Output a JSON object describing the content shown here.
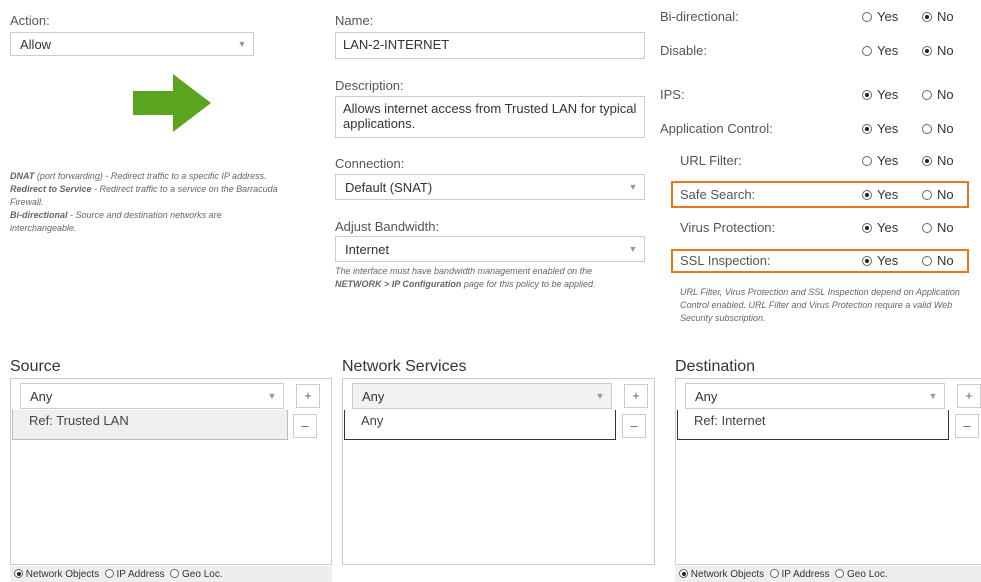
{
  "action": {
    "label": "Action:",
    "value": "Allow"
  },
  "help_left": {
    "dnat_term": "DNAT",
    "dnat_text": " (port forwarding) - Redirect traffic to a specific IP address.",
    "redirect_term": "Redirect to Service",
    "redirect_text": " - Redirect traffic to a service on the Barracuda Firewall.",
    "bidir_term": "Bi-directional",
    "bidir_text": " - Source and destination networks are interchangeable."
  },
  "name": {
    "label": "Name:",
    "value": "LAN-2-INTERNET"
  },
  "description": {
    "label": "Description:",
    "value": "Allows internet access from Trusted LAN for typical applications."
  },
  "connection": {
    "label": "Connection:",
    "value": "Default (SNAT)"
  },
  "bandwidth": {
    "label": "Adjust Bandwidth:",
    "value": "Internet",
    "help_pre": "The interface must have bandwidth management enabled on the ",
    "help_bold": "NETWORK > IP Configuration",
    "help_post": " page for this policy to be applied."
  },
  "options": [
    {
      "label": "Bi-directional:",
      "selected": "No"
    },
    {
      "label": "Disable:",
      "selected": "No"
    },
    {
      "label": "IPS:",
      "selected": "Yes"
    },
    {
      "label": "Application Control:",
      "selected": "Yes"
    },
    {
      "label": "URL Filter:",
      "selected": "No"
    },
    {
      "label": "Safe Search:",
      "selected": "Yes"
    },
    {
      "label": "Virus Protection:",
      "selected": "Yes"
    },
    {
      "label": "SSL Inspection:",
      "selected": "Yes"
    }
  ],
  "yes_label": "Yes",
  "no_label": "No",
  "options_help": "URL Filter, Virus Protection and SSL Inspection depend on Application Control enabled. URL Filter and Virus Protection require a valid Web Security subscription.",
  "highlight_color": "#e8761d",
  "source": {
    "title": "Source",
    "select": "Any",
    "item": "Ref: Trusted LAN"
  },
  "services": {
    "title": "Network Services",
    "select": "Any",
    "item": "Any"
  },
  "destination": {
    "title": "Destination",
    "select": "Any",
    "item": "Ref: Internet"
  },
  "footer": {
    "network_objects": "Network Objects",
    "ip_address": "IP Address",
    "geo_loc": "Geo Loc.",
    "selected": "Network Objects"
  },
  "plus": "+",
  "minus": "–",
  "arrow_color": "#5aa51f"
}
